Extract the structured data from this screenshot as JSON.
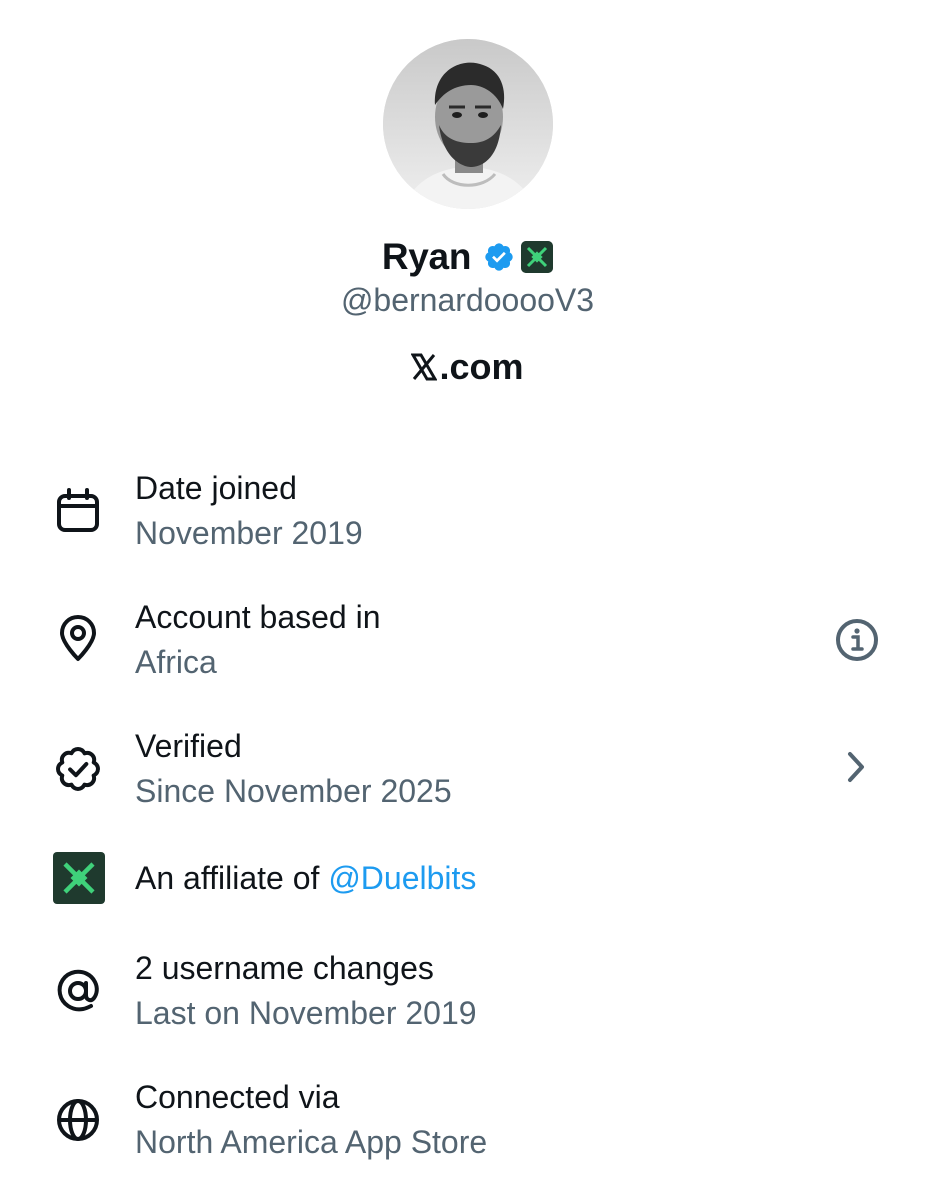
{
  "profile": {
    "name": "Ryan",
    "handle": "@bernardooooV3",
    "site": ".com",
    "verified_badge_icon": "verified-badge-icon",
    "affiliate_badge_icon": "duelbits-affiliate-badge-icon"
  },
  "about": [
    {
      "icon": "calendar-icon",
      "title": "Date joined",
      "sub": "November 2019"
    },
    {
      "icon": "location-pin-icon",
      "title": "Account based in",
      "sub": "Africa",
      "right_icon": "info-icon"
    },
    {
      "icon": "verified-outline-icon",
      "title": "Verified",
      "sub": "Since November 2025",
      "right_icon": "chevron-right-icon"
    },
    {
      "icon": "duelbits-logo-icon",
      "title_prefix": "An affiliate of ",
      "title_link": "@Duelbits"
    },
    {
      "icon": "at-sign-icon",
      "title": "2 username changes",
      "sub": "Last on November 2019"
    },
    {
      "icon": "globe-icon",
      "title": "Connected via",
      "sub": "North America App Store"
    }
  ],
  "colors": {
    "primary_text": "#0f1419",
    "secondary_text": "#536471",
    "link": "#1d9bf0",
    "verified_blue": "#1d9bf0",
    "affiliate_bg": "#1f3a2e",
    "affiliate_green": "#3fd17a"
  }
}
